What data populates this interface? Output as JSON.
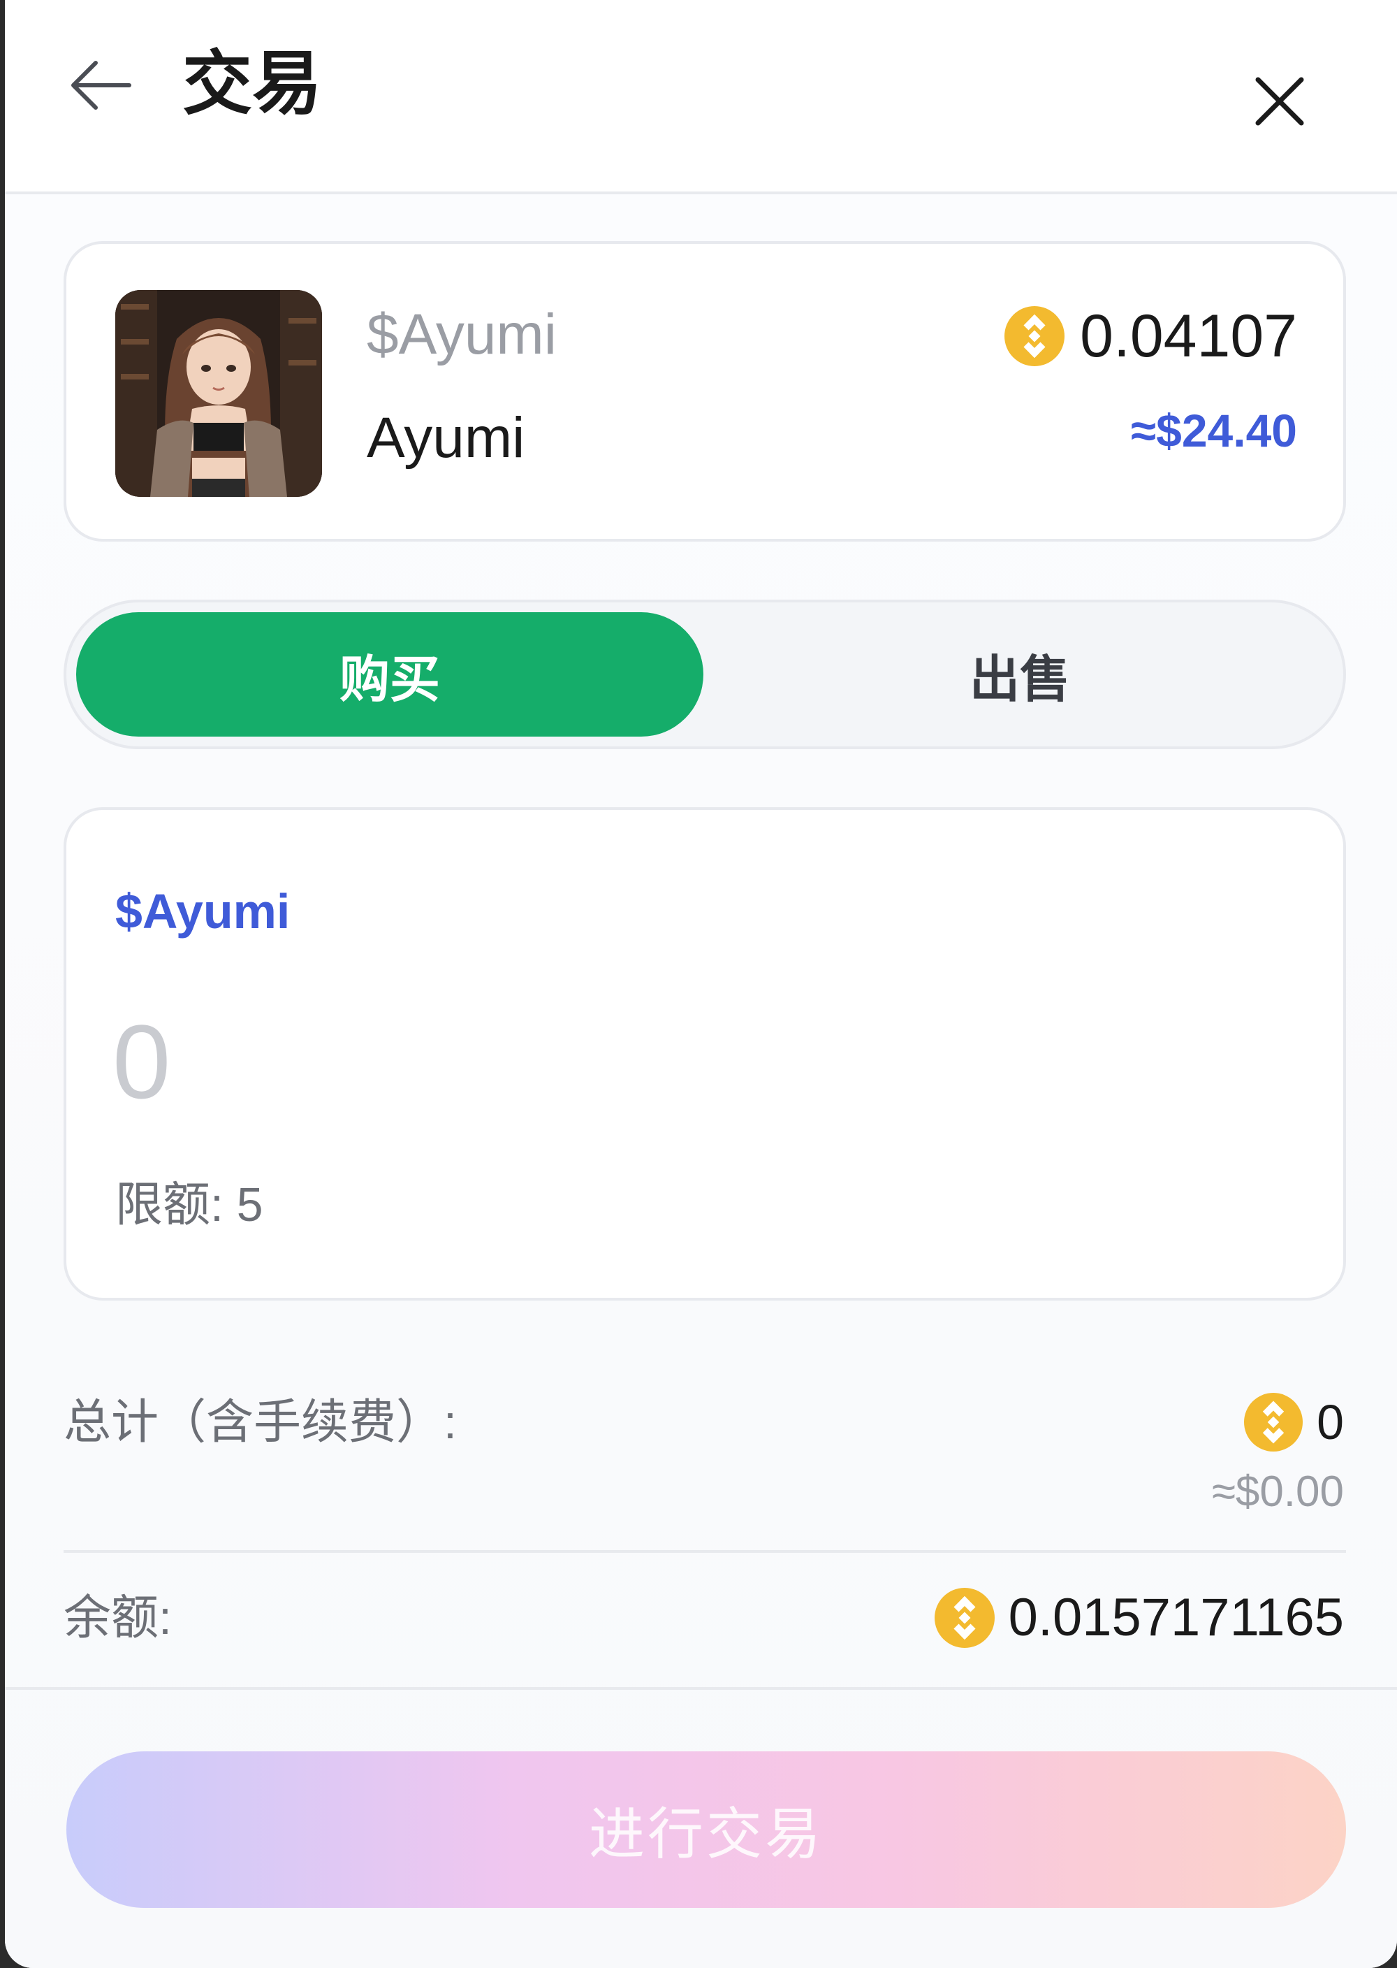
{
  "header": {
    "title": "交易",
    "back_icon": "arrow-left-icon",
    "close_icon": "close-icon"
  },
  "token": {
    "symbol": "$Ayumi",
    "name": "Ayumi",
    "price": "0.04107",
    "price_usd": "≈$24.40",
    "currency_icon": "bnb-coin-icon"
  },
  "tabs": {
    "buy": "购买",
    "sell": "出售",
    "active": "buy"
  },
  "amount": {
    "symbol": "$Ayumi",
    "placeholder": "0",
    "limit": "限额: 5"
  },
  "summary": {
    "total_label": "总计（含手续费）:",
    "total_value": "0",
    "total_usd": "≈$0.00",
    "balance_label": "余额:",
    "balance_value": "0.0157171165"
  },
  "submit": {
    "label": "进行交易"
  },
  "colors": {
    "buy_green": "#15ad6a",
    "accent_blue": "#3f5bd8",
    "coin_gold": "#f3ba2f"
  }
}
